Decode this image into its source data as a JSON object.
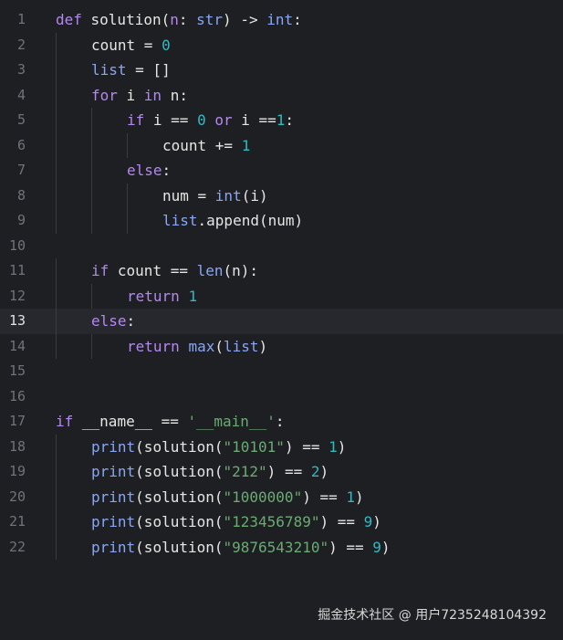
{
  "editor": {
    "current_line": "13",
    "lines": [
      {
        "number": "1",
        "tokens": [
          [
            "kw",
            "def "
          ],
          [
            "fn",
            "solution"
          ],
          [
            "txt",
            "("
          ],
          [
            "par",
            "n"
          ],
          [
            "txt",
            ": "
          ],
          [
            "bi",
            "str"
          ],
          [
            "txt",
            ") -> "
          ],
          [
            "bi",
            "int"
          ],
          [
            "txt",
            ":"
          ]
        ]
      },
      {
        "number": "2",
        "tokens": [
          [
            "txt",
            "count = "
          ],
          [
            "num",
            "0"
          ]
        ]
      },
      {
        "number": "3",
        "tokens": [
          [
            "bi",
            "list"
          ],
          [
            "txt",
            " = []"
          ]
        ]
      },
      {
        "number": "4",
        "tokens": [
          [
            "kw",
            "for "
          ],
          [
            "txt",
            "i "
          ],
          [
            "kw",
            "in "
          ],
          [
            "txt",
            "n:"
          ]
        ]
      },
      {
        "number": "5",
        "tokens": [
          [
            "kw",
            "if "
          ],
          [
            "txt",
            "i == "
          ],
          [
            "num",
            "0"
          ],
          [
            "kw",
            " or "
          ],
          [
            "txt",
            "i =="
          ],
          [
            "num",
            "1"
          ],
          [
            "txt",
            ":"
          ]
        ]
      },
      {
        "number": "6",
        "tokens": [
          [
            "txt",
            "count += "
          ],
          [
            "num",
            "1"
          ]
        ]
      },
      {
        "number": "7",
        "tokens": [
          [
            "kw",
            "else"
          ],
          [
            "txt",
            ":"
          ]
        ]
      },
      {
        "number": "8",
        "tokens": [
          [
            "txt",
            "num = "
          ],
          [
            "bi",
            "int"
          ],
          [
            "txt",
            "(i)"
          ]
        ]
      },
      {
        "number": "9",
        "tokens": [
          [
            "bi",
            "list"
          ],
          [
            "txt",
            ".append(num)"
          ]
        ]
      },
      {
        "number": "10",
        "tokens": []
      },
      {
        "number": "11",
        "tokens": [
          [
            "kw",
            "if "
          ],
          [
            "txt",
            "count == "
          ],
          [
            "bi",
            "len"
          ],
          [
            "txt",
            "(n):"
          ]
        ]
      },
      {
        "number": "12",
        "tokens": [
          [
            "kw",
            "return "
          ],
          [
            "num",
            "1"
          ]
        ]
      },
      {
        "number": "13",
        "tokens": [
          [
            "kw",
            "else"
          ],
          [
            "txt",
            ":"
          ]
        ]
      },
      {
        "number": "14",
        "tokens": [
          [
            "kw",
            "return "
          ],
          [
            "bi",
            "max"
          ],
          [
            "txt",
            "("
          ],
          [
            "bi",
            "list"
          ],
          [
            "txt",
            ")"
          ]
        ]
      },
      {
        "number": "15",
        "tokens": []
      },
      {
        "number": "16",
        "tokens": []
      },
      {
        "number": "17",
        "tokens": [
          [
            "kw",
            "if "
          ],
          [
            "txt",
            "__name__ == "
          ],
          [
            "str",
            "'__main__'"
          ],
          [
            "txt",
            ":"
          ]
        ]
      },
      {
        "number": "18",
        "tokens": [
          [
            "bi",
            "print"
          ],
          [
            "txt",
            "(solution("
          ],
          [
            "str",
            "\"10101\""
          ],
          [
            "txt",
            ") == "
          ],
          [
            "num",
            "1"
          ],
          [
            "txt",
            ")"
          ]
        ]
      },
      {
        "number": "19",
        "tokens": [
          [
            "bi",
            "print"
          ],
          [
            "txt",
            "(solution("
          ],
          [
            "str",
            "\"212\""
          ],
          [
            "txt",
            ") == "
          ],
          [
            "num",
            "2"
          ],
          [
            "txt",
            ")"
          ]
        ]
      },
      {
        "number": "20",
        "tokens": [
          [
            "bi",
            "print"
          ],
          [
            "txt",
            "(solution("
          ],
          [
            "str",
            "\"1000000\""
          ],
          [
            "txt",
            ") == "
          ],
          [
            "num",
            "1"
          ],
          [
            "txt",
            ")"
          ]
        ]
      },
      {
        "number": "21",
        "tokens": [
          [
            "bi",
            "print"
          ],
          [
            "txt",
            "(solution("
          ],
          [
            "str",
            "\"123456789\""
          ],
          [
            "txt",
            ") == "
          ],
          [
            "num",
            "9"
          ],
          [
            "txt",
            ")"
          ]
        ]
      },
      {
        "number": "22",
        "tokens": [
          [
            "bi",
            "print"
          ],
          [
            "txt",
            "(solution("
          ],
          [
            "str",
            "\"9876543210\""
          ],
          [
            "txt",
            ") == "
          ],
          [
            "num",
            "9"
          ],
          [
            "txt",
            ")"
          ]
        ]
      }
    ]
  },
  "watermark": "掘金技术社区 @ 用户7235248104392",
  "colors": {
    "background": "#1e1f22",
    "current_line": "#26282e",
    "keyword": "#b388f0",
    "builtin": "#88a6f5",
    "number": "#2fbac4",
    "string": "#6aab73",
    "gutter": "#6f737a"
  }
}
